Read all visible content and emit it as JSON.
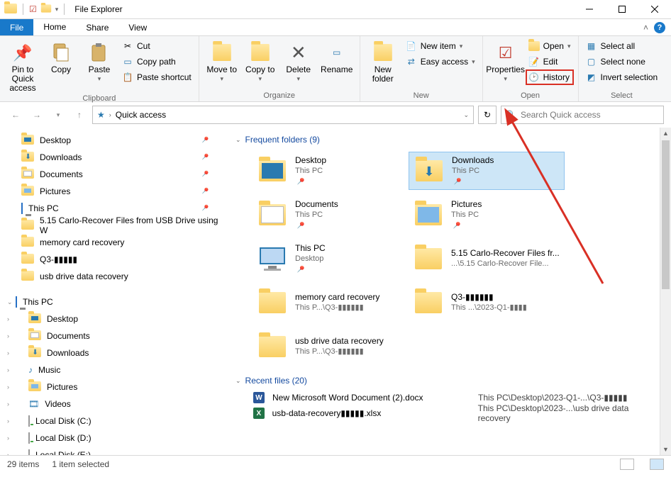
{
  "titlebar": {
    "title": "File Explorer"
  },
  "menubar": {
    "file": "File",
    "home": "Home",
    "share": "Share",
    "view": "View"
  },
  "ribbon": {
    "clipboard": {
      "pin": "Pin to Quick access",
      "copy": "Copy",
      "paste": "Paste",
      "cut": "Cut",
      "copy_path": "Copy path",
      "paste_shortcut": "Paste shortcut",
      "label": "Clipboard"
    },
    "organize": {
      "move_to": "Move to",
      "copy_to": "Copy to",
      "delete": "Delete",
      "rename": "Rename",
      "label": "Organize"
    },
    "new": {
      "new_folder": "New folder",
      "new_item": "New item",
      "easy_access": "Easy access",
      "label": "New"
    },
    "open": {
      "properties": "Properties",
      "open": "Open",
      "edit": "Edit",
      "history": "History",
      "label": "Open"
    },
    "select": {
      "select_all": "Select all",
      "select_none": "Select none",
      "invert": "Invert selection",
      "label": "Select"
    }
  },
  "nav": {
    "breadcrumb": "Quick access",
    "search_placeholder": "Search Quick access"
  },
  "navpane": {
    "quick": [
      {
        "name": "Desktop",
        "icon": "desktop"
      },
      {
        "name": "Downloads",
        "icon": "downloads"
      },
      {
        "name": "Documents",
        "icon": "documents"
      },
      {
        "name": "Pictures",
        "icon": "pictures"
      },
      {
        "name": "This PC",
        "icon": "thispc"
      },
      {
        "name": "5.15 Carlo-Recover Files from USB Drive using W",
        "icon": "folder"
      },
      {
        "name": "memory card recovery",
        "icon": "folder"
      },
      {
        "name": "Q3-▮▮▮▮▮",
        "icon": "folder"
      },
      {
        "name": "usb drive data recovery",
        "icon": "folder"
      }
    ],
    "thispc_label": "This PC",
    "thispc": [
      {
        "name": "Desktop"
      },
      {
        "name": "Documents"
      },
      {
        "name": "Downloads"
      },
      {
        "name": "Music"
      },
      {
        "name": "Pictures"
      },
      {
        "name": "Videos"
      },
      {
        "name": "Local Disk (C:)"
      },
      {
        "name": "Local Disk (D:)"
      },
      {
        "name": "Local Disk (E:)"
      }
    ]
  },
  "content": {
    "frequent_label": "Frequent folders (9)",
    "recent_label": "Recent files (20)",
    "folders": [
      {
        "name": "Desktop",
        "sub": "This PC",
        "icon": "desktop-folder",
        "pinned": true
      },
      {
        "name": "Downloads",
        "sub": "This PC",
        "icon": "downloads-folder",
        "pinned": true,
        "selected": true
      },
      {
        "name": "Documents",
        "sub": "This PC",
        "icon": "documents-folder",
        "pinned": true
      },
      {
        "name": "Pictures",
        "sub": "This PC",
        "icon": "pictures-folder",
        "pinned": true
      },
      {
        "name": "This PC",
        "sub": "Desktop",
        "icon": "thispc",
        "pinned": true
      },
      {
        "name": "5.15 Carlo-Recover Files fr...",
        "sub": "...\\5.15 Carlo-Recover File...",
        "icon": "folder"
      },
      {
        "name": "memory card recovery",
        "sub": "This P...\\Q3-▮▮▮▮▮▮",
        "icon": "folder"
      },
      {
        "name": "Q3-▮▮▮▮▮▮",
        "sub": "This ...\\2023-Q1-▮▮▮▮",
        "icon": "folder"
      },
      {
        "name": "usb drive data recovery",
        "sub": "This P...\\Q3-▮▮▮▮▮▮",
        "icon": "folder"
      }
    ],
    "recent": [
      {
        "name": "New Microsoft Word Document (2).docx",
        "path": "This PC\\Desktop\\2023-Q1-...\\Q3-▮▮▮▮▮",
        "icon": "word"
      },
      {
        "name": "usb-data-recovery▮▮▮▮▮.xlsx",
        "path": "This PC\\Desktop\\2023-...\\usb drive data recovery",
        "icon": "excel"
      }
    ]
  },
  "status": {
    "items": "29 items",
    "selected": "1 item selected"
  }
}
